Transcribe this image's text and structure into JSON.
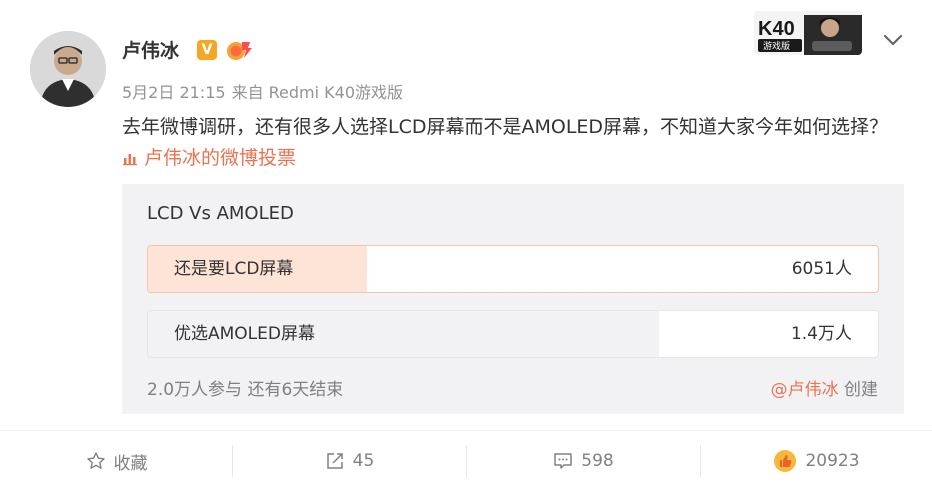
{
  "author": {
    "name": "卢伟冰",
    "verified_badge": "V",
    "time": "5月2日 21:15",
    "source": "来自 Redmi K40游戏版"
  },
  "promo": {
    "title": "K40",
    "subtitle": "游戏版"
  },
  "post": {
    "text": "去年微博调研，还有很多人选择LCD屏幕而不是AMOLED屏幕，不知道大家今年如何选择？",
    "poll_link": "卢伟冰的微博投票"
  },
  "poll": {
    "title": "LCD Vs AMOLED",
    "options": [
      {
        "label": "还是要LCD屏幕",
        "count": "6051人",
        "share": 0.3
      },
      {
        "label": "优选AMOLED屏幕",
        "count": "1.4万人",
        "share": 0.7
      }
    ],
    "footer": "2.0万人参与 还有6天结束",
    "creator_handle": "@卢伟冰",
    "creator_suffix": "创建"
  },
  "toolbar": {
    "favorite_label": "收藏",
    "repost_count": "45",
    "comment_count": "598",
    "like_count": "20923"
  },
  "colors": {
    "accent": "#eb7350",
    "muted": "#808080",
    "card_bg": "#f2f2f5",
    "option_fill": "#fde4d6"
  }
}
